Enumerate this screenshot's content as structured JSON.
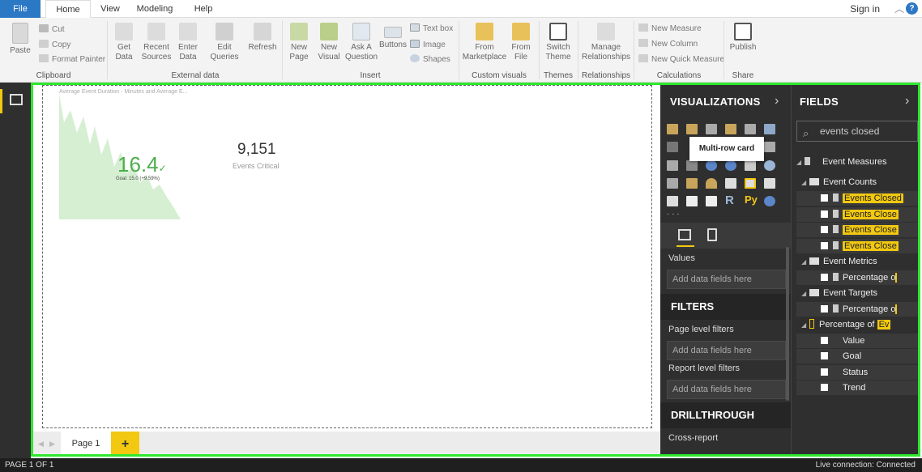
{
  "menu": {
    "file": "File",
    "home": "Home",
    "view": "View",
    "modeling": "Modeling",
    "help": "Help",
    "sign_in": "Sign in"
  },
  "ribbon": {
    "paste": "Paste",
    "cut": "Cut",
    "copy": "Copy",
    "format_painter": "Format Painter",
    "get_data": "Get Data",
    "recent_sources": "Recent Sources",
    "enter_data": "Enter Data",
    "edit_queries": "Edit Queries",
    "refresh": "Refresh",
    "new_page": "New Page",
    "new_visual": "New Visual",
    "ask_question": "Ask A Question",
    "buttons": "Buttons",
    "text_box": "Text box",
    "image": "Image",
    "shapes": "Shapes",
    "from_marketplace": "From Marketplace",
    "from_file": "From File",
    "switch_theme": "Switch Theme",
    "manage_relationships": "Manage Relationships",
    "new_measure": "New Measure",
    "new_column": "New Column",
    "new_quick_measure": "New Quick Measure",
    "publish": "Publish",
    "groups": {
      "clipboard": "Clipboard",
      "external_data": "External data",
      "insert": "Insert",
      "custom_visuals": "Custom visuals",
      "themes": "Themes",
      "relationships": "Relationships",
      "calculations": "Calculations",
      "share": "Share"
    }
  },
  "report": {
    "chart_title": "Average Event Duration - Minutes and Average E...",
    "kpi_value": "16.4",
    "kpi_check": "✓",
    "kpi_goal": "Goal: 15.0 (+9.59%)",
    "card_value": "9,151",
    "card_label": "Events Critical"
  },
  "pages": {
    "page1": "Page 1",
    "add": "+"
  },
  "viz": {
    "header": "VISUALIZATIONS",
    "tooltip": "Multi-row card",
    "more": "· · ·",
    "values_label": "Values",
    "add_fields": "Add data fields here",
    "filters_header": "FILTERS",
    "page_filters": "Page level filters",
    "report_filters": "Report level filters",
    "drillthrough_header": "DRILLTHROUGH",
    "cross_report": "Cross-report",
    "r_glyph": "R",
    "py_glyph": "Py",
    "chevron": "›"
  },
  "fields": {
    "header": "FIELDS",
    "chevron": "›",
    "search_value": "events closed",
    "tree": {
      "event_measures": "Event Measures",
      "event_counts": "Event Counts",
      "ec1": "Events Closed",
      "ec2": "Events Close",
      "ec3": "Events Close",
      "ec4": "Events Close",
      "event_metrics": "Event Metrics",
      "pct1": "Percentage o",
      "event_targets": "Event Targets",
      "pct2": "Percentage o",
      "kpi_name": "Percentage of ",
      "kpi_hl": "Ev",
      "value": "Value",
      "goal": "Goal",
      "status": "Status",
      "trend": "Trend"
    }
  },
  "status": {
    "page": "PAGE 1 OF 1",
    "connection": "Live connection: Connected"
  },
  "colors": {
    "accent": "#f2c811",
    "file_blue": "#2b78c5",
    "frame_green": "#2ee82e",
    "kpi_green": "#4cae4c"
  }
}
